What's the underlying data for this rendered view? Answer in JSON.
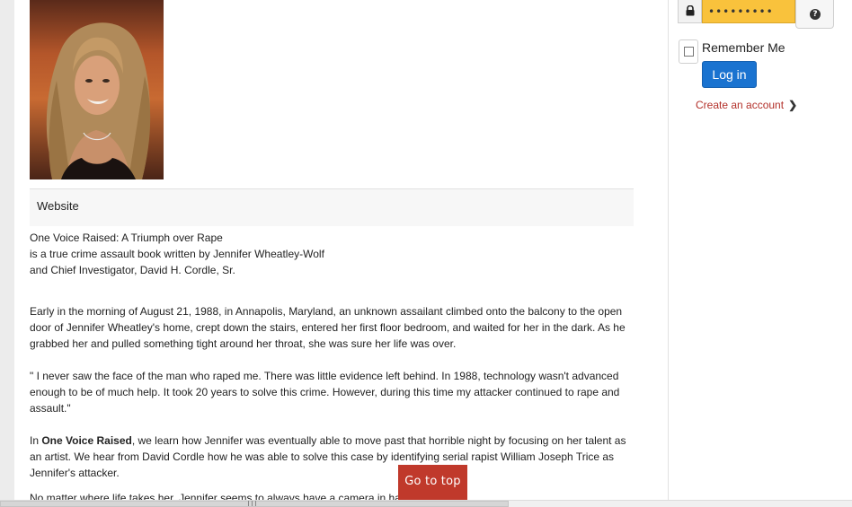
{
  "login": {
    "password_value": "•••••••••",
    "remember_label": "Remember Me",
    "login_label": "Log in",
    "create_account_label": "Create an account",
    "chevron": "❯"
  },
  "profile": {
    "website_label": "Website"
  },
  "article": {
    "intro_line1": "One Voice Raised: A Triumph over Rape",
    "intro_line2": "is a true crime assault book written by Jennifer Wheatley-Wolf",
    "intro_line3": "and Chief Investigator, David H. Cordle, Sr.",
    "para1": " Early in the morning of August 21, 1988, in Annapolis, Maryland, an unknown assailant climbed onto the balcony to the open door of Jennifer Wheatley's home, crept down the stairs, entered her first floor bedroom, and waited for her in the dark. As he grabbed her and pulled something tight around her throat, she was sure her life was over.",
    "para2": "\" I never saw the face of the man who raped me. There was little evidence left behind. In 1988, technology wasn't advanced enough to be of much help. It took 20 years to solve this crime. However, during this time my attacker continued to rape and assault.\"",
    "para3_prefix": "In ",
    "para3_bold": "One Voice Raised",
    "para3_rest": ", we learn how Jennifer was eventually able to move past that horrible night by focusing on her talent as an artist. We hear from David Cordle how he was able to solve this case by identifying serial rapist William Joseph Trice as Jennifer's attacker.",
    "para4_partial": "No matter where life takes her, Jennifer seems to always have a camera in ha"
  },
  "go_to_top_label": "Go to top",
  "icons": {
    "lock": "lock-icon",
    "help": "question-circle-icon",
    "chevron": "chevron-right-icon"
  },
  "colors": {
    "password_bg": "#f9c23c",
    "login_button": "#1a73d0",
    "create_link": "#b3302a",
    "go_top_bg": "#c0392b"
  }
}
